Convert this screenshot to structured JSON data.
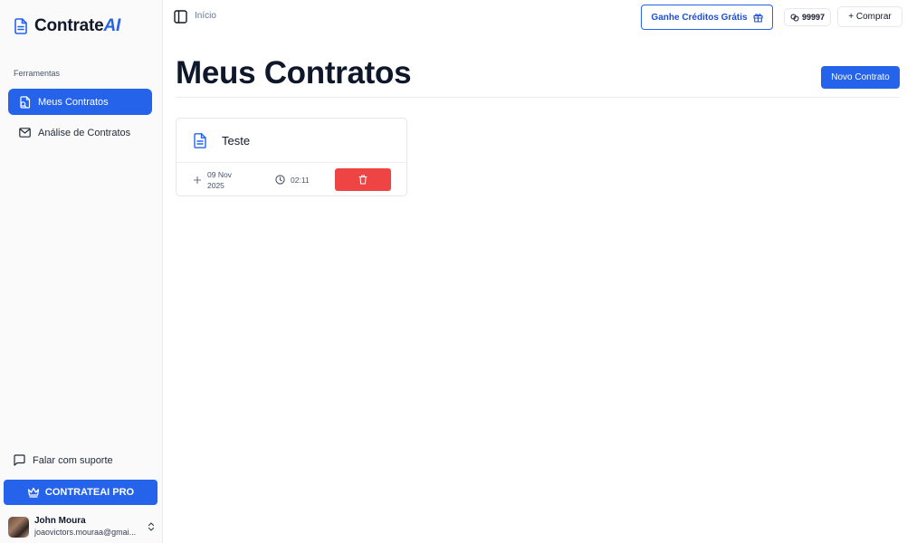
{
  "brand": {
    "name_main": "Contrate",
    "name_accent": "AI",
    "icon": "document-icon"
  },
  "sidebar": {
    "section_label": "Ferramentas",
    "items": [
      {
        "label": "Meus Contratos",
        "icon": "contract-list-icon",
        "active": true
      },
      {
        "label": "Análise de Contratos",
        "icon": "mail-icon",
        "active": false
      }
    ],
    "support_label": "Falar com suporte",
    "pro_label": "CONTRATEAI PRO",
    "user": {
      "name": "John Moura",
      "email": "joaovictors.mouraa@gmai..."
    }
  },
  "topbar": {
    "breadcrumb": "Início",
    "credits_label": "Ganhe Créditos Grátis",
    "balance": "99997",
    "buy_label": "+ Comprar"
  },
  "main": {
    "title": "Meus Contratos",
    "new_button": "Novo Contrato",
    "contracts": [
      {
        "title": "Teste",
        "date": "09 Nov 2025",
        "time": "02:11"
      }
    ]
  },
  "colors": {
    "accent": "#2563eb",
    "danger": "#ef4444",
    "sidebar_bg": "#fafafa"
  }
}
